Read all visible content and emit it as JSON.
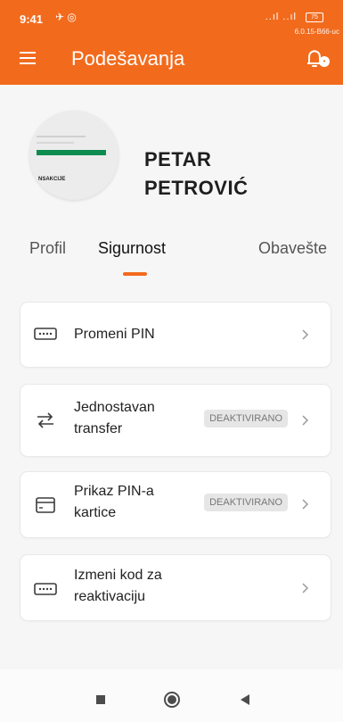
{
  "status_bar": {
    "time": "9:41",
    "signal": "..ıl ..ıl",
    "battery": "75",
    "version": "6.0.15-B66-uc"
  },
  "header": {
    "title": "Podešavanja"
  },
  "profile": {
    "first_name": "PETAR",
    "last_name": "PETROVIĆ",
    "avatar_text": "NSAKCIJE"
  },
  "tabs": [
    {
      "label": "Profil"
    },
    {
      "label": "Sigurnost"
    },
    {
      "label": "Obavešte"
    }
  ],
  "settings": [
    {
      "label_line1": "Promeni PIN",
      "label_line2": "",
      "status": "",
      "icon": "keypad-icon"
    },
    {
      "label_line1": "Jednostavan",
      "label_line2": "transfer",
      "status": "DEAKTIVIRANO",
      "icon": "transfer-arrows-icon"
    },
    {
      "label_line1": "Prikaz PIN-a",
      "label_line2": "kartice",
      "status": "DEAKTIVIRANO",
      "icon": "card-icon"
    },
    {
      "label_line1": "Izmeni kod za",
      "label_line2": "reaktivaciju",
      "status": "",
      "icon": "keypad-icon"
    }
  ],
  "colors": {
    "accent": "#f26b1d",
    "background": "#f6f6f6",
    "badge_bg": "#e6e6e6"
  }
}
